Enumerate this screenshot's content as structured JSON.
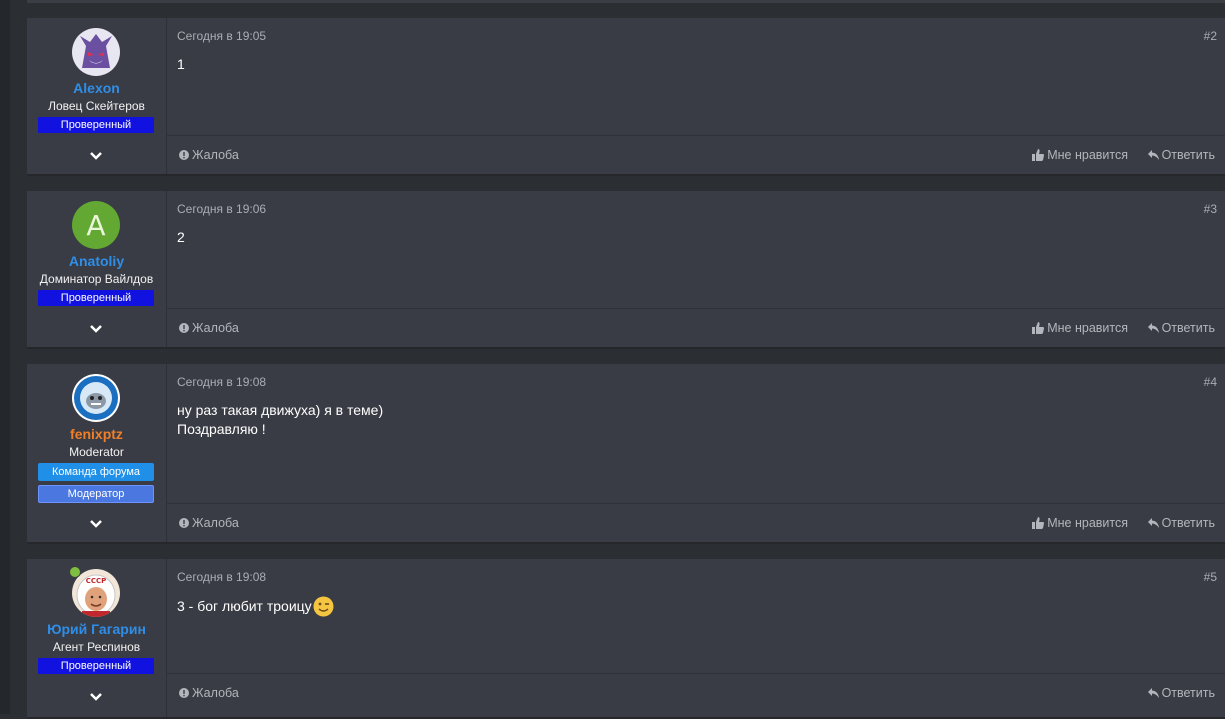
{
  "posts": [
    {
      "username": "Alexon",
      "user_title": "Ловец Скейтеров",
      "badges": [
        "Проверенный"
      ],
      "date": "Сегодня в 19:05",
      "number": "#2",
      "lines": [
        "1"
      ],
      "report": "Жалоба",
      "like": "Мне нравится",
      "reply": "Ответить"
    },
    {
      "username": "Anatoliy",
      "avatar_letter": "A",
      "user_title": "Доминатор Вайлдов",
      "badges": [
        "Проверенный"
      ],
      "date": "Сегодня в 19:06",
      "number": "#3",
      "lines": [
        "2"
      ],
      "report": "Жалоба",
      "like": "Мне нравится",
      "reply": "Ответить"
    },
    {
      "username": "fenixptz",
      "user_title": "Moderator",
      "badges": [
        "Команда форума",
        "Модератор"
      ],
      "date": "Сегодня в 19:08",
      "number": "#4",
      "lines": [
        "ну раз такая движуха) я в теме)",
        "Поздравляю !"
      ],
      "report": "Жалоба",
      "like": "Мне нравится",
      "reply": "Ответить"
    },
    {
      "username": "Юрий Гагарин",
      "user_title": "Агент Респинов",
      "badges": [
        "Проверенный"
      ],
      "date": "Сегодня в 19:08",
      "number": "#5",
      "lines": [
        "3 - бог любит троицу"
      ],
      "report": "Жалоба",
      "reply": "Ответить"
    }
  ],
  "colors": {
    "username_blue": "#2f8ee8",
    "username_orange": "#f07f28",
    "verified_badge": "#1111e0",
    "team_badge": "#1f8fe8",
    "mod_badge": "#4a78e0",
    "online": "#7fbf3f"
  },
  "icons": [
    "chevron-down-icon",
    "info-icon",
    "thumbs-up-icon",
    "reply-icon",
    "wink-emoji-icon"
  ]
}
